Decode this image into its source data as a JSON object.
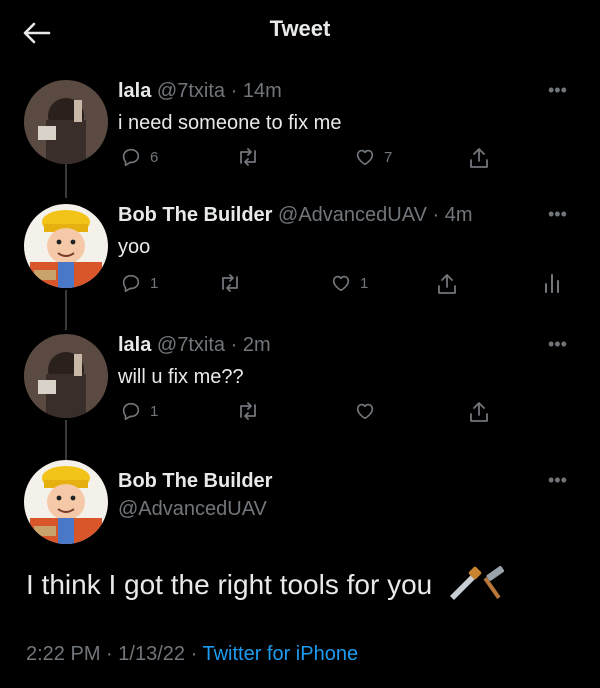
{
  "header": {
    "title": "Tweet"
  },
  "tweets": [
    {
      "name": "lala",
      "handle": "@7txita",
      "sep": "·",
      "time": "14m",
      "text": "i need someone to fix me",
      "replies": "6",
      "retweets": "",
      "likes": "7"
    },
    {
      "name": "Bob The Builder",
      "handle": "@AdvancedUAV",
      "sep": "·",
      "time": "4m",
      "text": "yoo",
      "replies": "1",
      "retweets": "",
      "likes": "1"
    },
    {
      "name": "lala",
      "handle": "@7txita",
      "sep": "·",
      "time": "2m",
      "text": "will u fix me??",
      "replies": "1",
      "retweets": "",
      "likes": ""
    }
  ],
  "main": {
    "name": "Bob The Builder",
    "handle": "@AdvancedUAV",
    "text": "I think I got the right tools for you",
    "time": "2:22 PM",
    "sep1": "·",
    "date": "1/13/22",
    "sep2": "·",
    "source": "Twitter for iPhone"
  },
  "icons": {
    "back": "arrow-left-icon",
    "reply": "reply-icon",
    "retweet": "retweet-icon",
    "like": "heart-icon",
    "share": "share-icon",
    "analytics": "analytics-icon",
    "more": "more-icon",
    "tools": "saw-hammer-emoji"
  },
  "colors": {
    "background": "#000000",
    "text": "#e7e9ea",
    "muted": "#71767b",
    "link": "#1d9bf0"
  }
}
